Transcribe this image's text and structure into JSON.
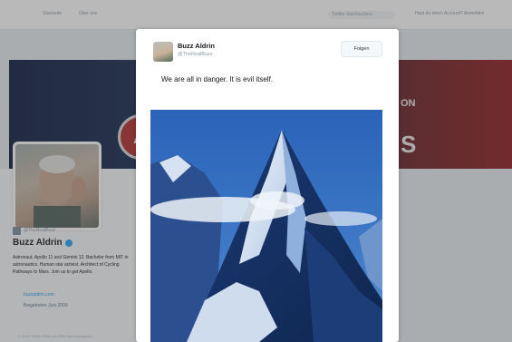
{
  "topbar": {
    "nav_left_1": "Startseite",
    "nav_left_2": "Über uns",
    "search_placeholder": "Twitter durchsuchen",
    "right_links": "Hast du einen Account? Anmelden"
  },
  "banner": {
    "logo_letter": "A",
    "text_on": "ON",
    "text_s": "S"
  },
  "profile": {
    "handle_small": "@TheRealBuzz",
    "name": "Buzz Aldrin",
    "bio": "Astronaut, Apollo 11 and Gemini 12. Bachelor from MIT in astronautics. Human star activist. Architect of Cycling Pathways to Mars. Join us to get Apollo.",
    "link": "buzzaldrin.com",
    "joined": "Beigetreten Juni 2009",
    "footer": "© 2016 Twitter   Über uns   Hilfe   Werbeangebote"
  },
  "tweet": {
    "name": "Buzz Aldrin",
    "handle": "@TheRealBuzz",
    "follow_label": "Folgen",
    "text": "We are all in danger. It is evil itself."
  },
  "colors": {
    "link": "#1da1f2",
    "banner_left": "#0b1a3d",
    "banner_right": "#8e1b1e"
  }
}
